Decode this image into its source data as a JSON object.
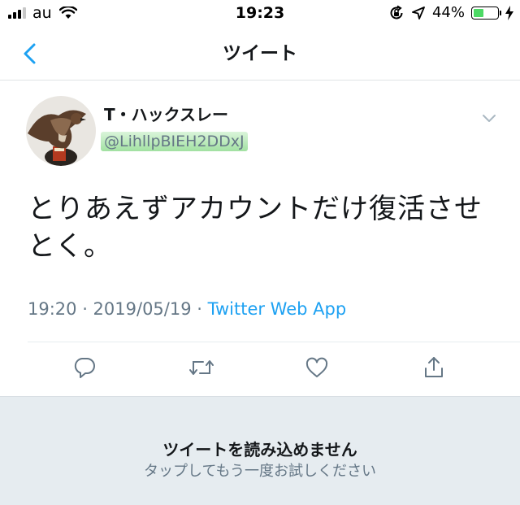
{
  "status_bar": {
    "carrier": "au",
    "time": "19:23",
    "battery_percent": "44%",
    "battery_level": 0.44,
    "icons": [
      "signal-icon",
      "wifi-icon",
      "orientation-lock-icon",
      "location-icon",
      "battery-icon",
      "charging-icon"
    ]
  },
  "nav": {
    "back_icon": "chevron-left-icon",
    "title": "ツイート"
  },
  "tweet": {
    "display_name": "T・ハックスレー",
    "handle": "@LihllpBIEH2DDxJ",
    "text": "とりあえずアカウントだけ復活させとく。",
    "timestamp": "19:20 · 2019/05/19 · ",
    "source": "Twitter Web App",
    "menu_icon": "chevron-down-icon",
    "actions": [
      "reply-icon",
      "retweet-icon",
      "like-icon",
      "share-icon"
    ]
  },
  "error": {
    "title": "ツイートを読み込めません",
    "subtitle": "タップしてもう一度お試しください"
  },
  "colors": {
    "accent": "#1da1f2",
    "muted": "#657786",
    "text": "#14171a",
    "error_bg": "#e6ecf0",
    "handle_highlight": "#8fdc8f"
  }
}
